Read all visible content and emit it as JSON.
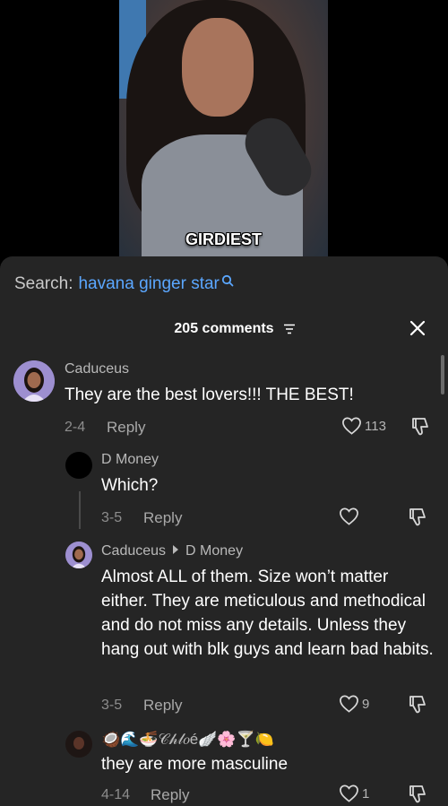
{
  "video": {
    "caption": "GIRDIEST"
  },
  "search": {
    "label": "Search:",
    "query": "havana ginger star",
    "icon": "search-icon"
  },
  "comments_header": {
    "count_label": "205 comments",
    "filter_icon": "filter-icon",
    "close_icon": "close-icon"
  },
  "comments": [
    {
      "author": "Caduceus",
      "text": "They are the best lovers!!! THE BEST!",
      "date": "2-4",
      "reply_label": "Reply",
      "likes": "113"
    },
    {
      "author": "D Money",
      "text": "Which?",
      "date": "3-5",
      "reply_label": "Reply",
      "likes": ""
    },
    {
      "author": "Caduceus",
      "reply_to": "D Money",
      "text": "Almost ALL of them. Size won’t matter either. They are meticulous and methodical and do not miss any details. Unless they hang out with blk guys and learn bad habits.",
      "date": "3-5",
      "reply_label": "Reply",
      "likes": "9"
    },
    {
      "author": "🥥🌊🍜𝒞𝒽𝓁𝑜é🪽🌸🍸🍋",
      "text": "they are more masculine",
      "date": "4-14",
      "reply_label": "Reply",
      "likes": "1"
    }
  ],
  "colors": {
    "sheet_bg": "#252525",
    "link_blue": "#5ba7ff",
    "muted": "#8d8d8d"
  }
}
